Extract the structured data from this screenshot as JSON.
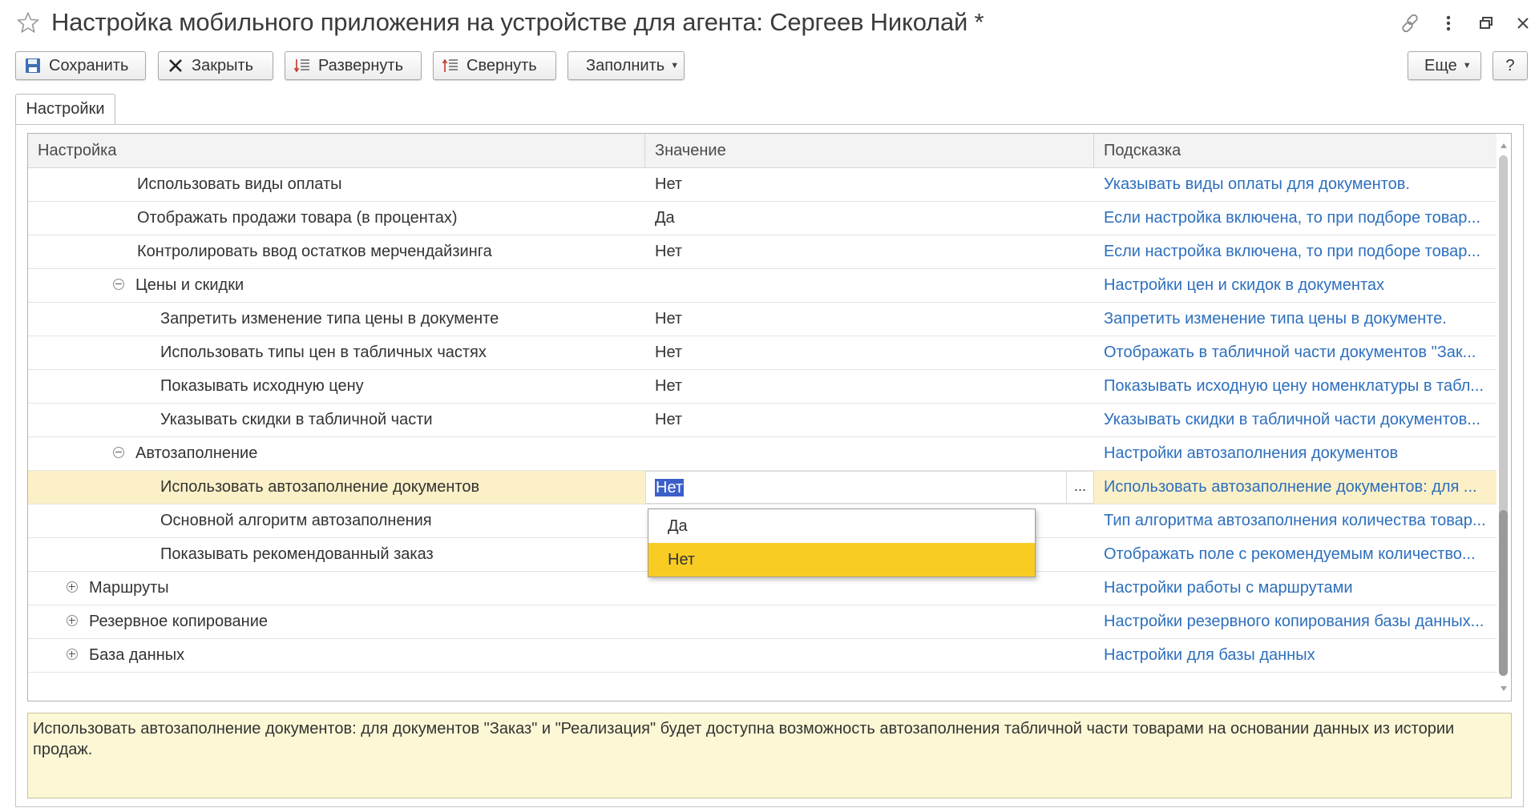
{
  "window": {
    "title": "Настройка мобильного приложения на устройстве для агента: Сергеев Николай *"
  },
  "toolbar": {
    "save_label": "Сохранить",
    "close_label": "Закрыть",
    "expand_label": "Развернуть",
    "collapse_label": "Свернуть",
    "fill_label": "Заполнить",
    "more_label": "Еще",
    "help_label": "?"
  },
  "tabs": [
    {
      "label": "Настройки"
    }
  ],
  "grid": {
    "columns": [
      "Настройка",
      "Значение",
      "Подсказка"
    ],
    "rows": [
      {
        "name": "Использовать виды оплаты",
        "value": "Нет",
        "hint": "Указывать виды оплаты для документов."
      },
      {
        "name": "Отображать продажи товара (в процентах)",
        "value": "Да",
        "hint": "Если настройка включена, то при подборе товар..."
      },
      {
        "name": "Контролировать ввод остатков мерчендайзинга",
        "value": "Нет",
        "hint": "Если настройка включена, то при подборе товар..."
      },
      {
        "name": "Цены и скидки",
        "value": "",
        "hint": "Настройки цен и скидок в документах",
        "group": "expanded"
      },
      {
        "name": "Запретить изменение типа цены в документе",
        "value": "Нет",
        "hint": "Запретить изменение типа цены в документе."
      },
      {
        "name": "Использовать типы цен в табличных частях",
        "value": "Нет",
        "hint": "Отображать в табличной части документов \"Зак..."
      },
      {
        "name": "Показывать исходную цену",
        "value": "Нет",
        "hint": "Показывать исходную цену номенклатуры в табл..."
      },
      {
        "name": "Указывать скидки в табличной части",
        "value": "Нет",
        "hint": "Указывать скидки в табличной части документов..."
      },
      {
        "name": "Автозаполнение",
        "value": "",
        "hint": "Настройки автозаполнения документов",
        "group": "expanded"
      },
      {
        "name": "Использовать автозаполнение документов",
        "value": "Нет",
        "hint": "Использовать автозаполнение документов: для ...",
        "selected": true
      },
      {
        "name": "Основной алгоритм автозаполнения",
        "value": "",
        "hint": "Тип алгоритма автозаполнения количества товар..."
      },
      {
        "name": "Показывать рекомендованный заказ",
        "value": "",
        "hint": "Отображать поле с рекомендуемым количество..."
      },
      {
        "name": "Маршруты",
        "value": "",
        "hint": "Настройки работы с маршрутами",
        "group": "collapsed"
      },
      {
        "name": "Резервное копирование",
        "value": "",
        "hint": "Настройки резервного копирования базы данных...",
        "group": "collapsed"
      },
      {
        "name": "База данных",
        "value": "",
        "hint": "Настройки для базы данных",
        "group": "collapsed"
      }
    ],
    "edit_dots": "..."
  },
  "dropdown": {
    "options": [
      "Да",
      "Нет"
    ],
    "selected": "Нет"
  },
  "hint_panel": {
    "text": "Использовать автозаполнение документов: для документов \"Заказ\" и \"Реализация\" будет доступна возможность автозаполнения табличной части товарами на основании данных из истории продаж."
  },
  "colors": {
    "hint_link": "#2e6fbd",
    "selected_row": "#fbf0c7",
    "dropdown_active": "#f9cc24",
    "hint_panel_bg": "#fcf8d6",
    "text_selection": "#3b5fc9"
  },
  "icons": {
    "favorite": "star-icon",
    "link": "link-icon",
    "menu": "more-vertical-icon",
    "restore": "restore-window-icon",
    "close": "close-icon",
    "save": "floppy-disk-icon",
    "close_form": "x-icon",
    "expand": "expand-tree-icon",
    "collapse": "collapse-tree-icon"
  }
}
